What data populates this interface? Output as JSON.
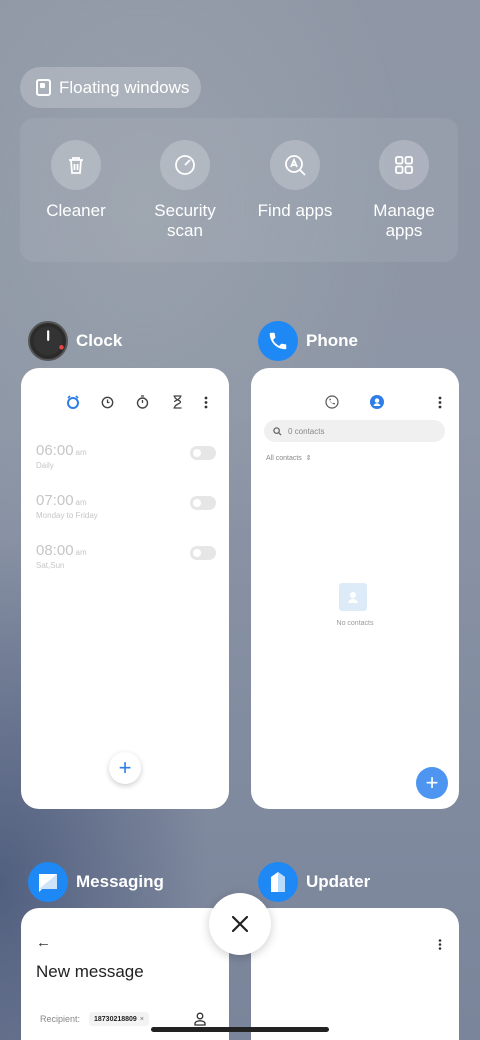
{
  "floating_windows": {
    "label": "Floating windows",
    "icon": "floating-window-icon"
  },
  "quick_actions": [
    {
      "label": "Cleaner",
      "icon": "trash-icon"
    },
    {
      "label": "Security\nscan",
      "line1": "Security",
      "line2": "scan",
      "icon": "security-scan-icon"
    },
    {
      "label": "Find apps",
      "icon": "find-apps-icon"
    },
    {
      "label": "Manage\napps",
      "line1": "Manage",
      "line2": "apps",
      "icon": "grid-icon"
    }
  ],
  "apps": {
    "clock": {
      "name": "Clock",
      "tab_icons": [
        "alarm-icon",
        "clock-icon",
        "stopwatch-icon",
        "timer-icon",
        "more-icon"
      ],
      "alarms": [
        {
          "time": "06:00",
          "ampm": "am",
          "days": "Daily",
          "enabled": false
        },
        {
          "time": "07:00",
          "ampm": "am",
          "days": "Monday to Friday",
          "enabled": false
        },
        {
          "time": "08:00",
          "ampm": "am",
          "days": "Sat,Sun",
          "enabled": false
        }
      ],
      "fab": "+"
    },
    "phone": {
      "name": "Phone",
      "search_placeholder": "0 contacts",
      "filter_label": "All contacts",
      "empty_label": "No contacts",
      "fab": "+"
    },
    "messaging": {
      "name": "Messaging",
      "title": "New message",
      "recipient_label": "Recipient:",
      "recipient_chip": "18730218809",
      "chip_close": "×"
    },
    "updater": {
      "name": "Updater"
    }
  },
  "colors": {
    "accent": "#2f7de6",
    "phone_blue": "#1e88f5",
    "fab_blue": "#4d95f0"
  }
}
